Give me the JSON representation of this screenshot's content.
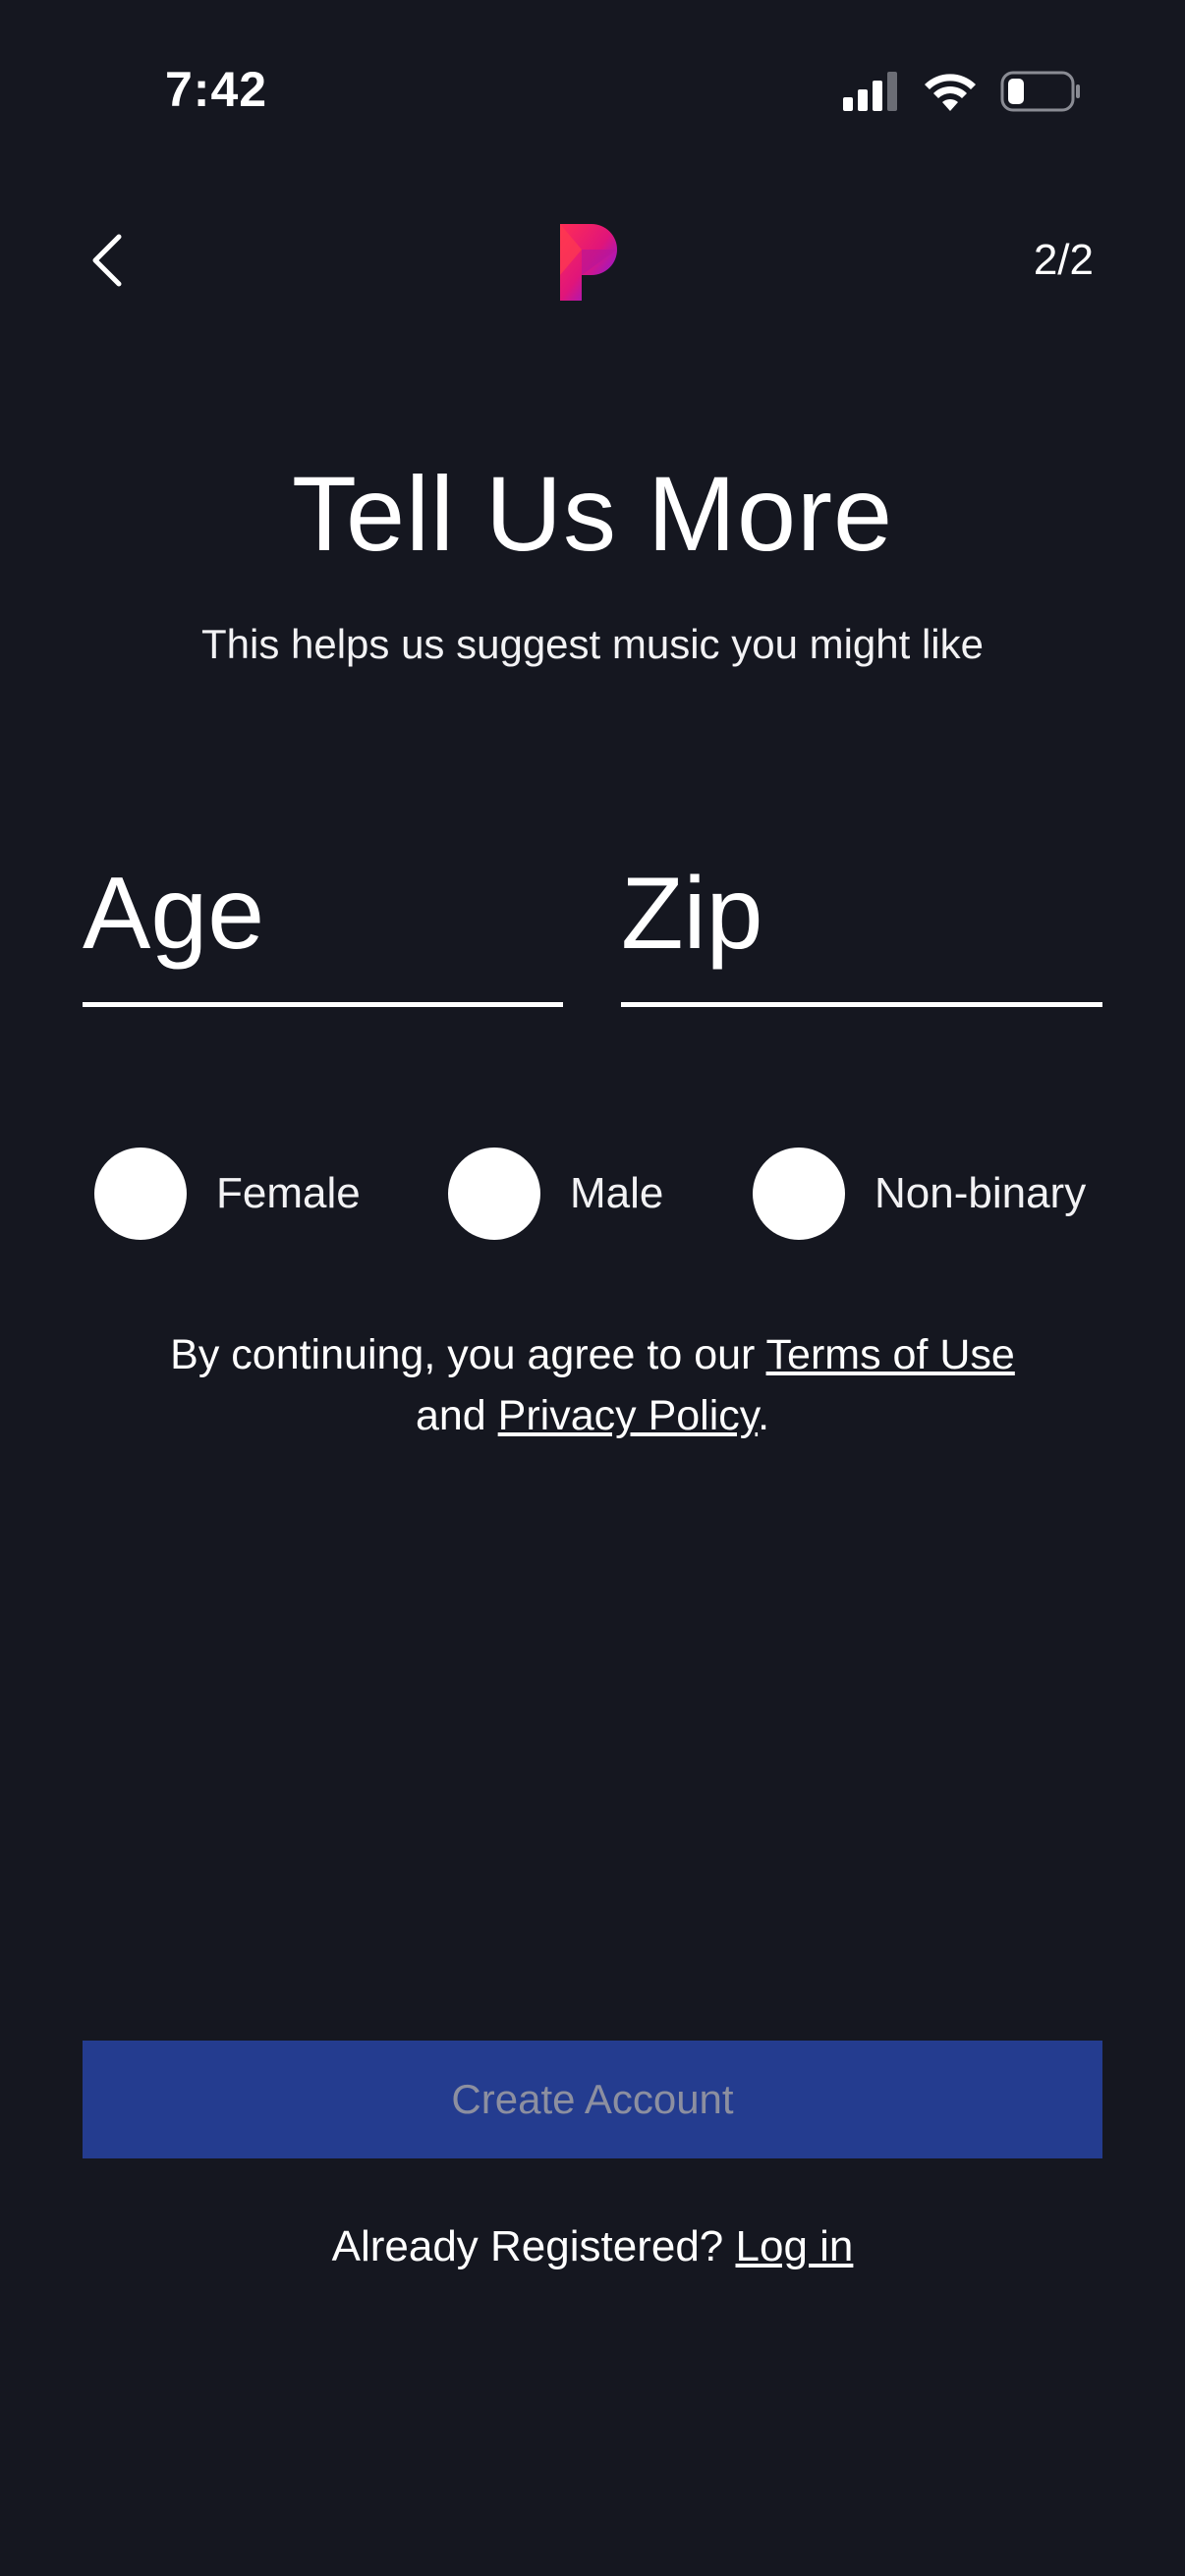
{
  "status_bar": {
    "time": "7:42",
    "icons": [
      "cellular-signal-icon",
      "wifi-icon",
      "battery-icon"
    ]
  },
  "header": {
    "back_icon": "chevron-left-icon",
    "logo": "pandora-logo",
    "step": "2/2"
  },
  "main": {
    "title": "Tell Us More",
    "subtitle": "This helps us suggest music you might like"
  },
  "form": {
    "age_placeholder": "Age",
    "zip_placeholder": "Zip",
    "gender_options": [
      {
        "label": "Female",
        "selected": false
      },
      {
        "label": "Male",
        "selected": false
      },
      {
        "label": "Non-binary",
        "selected": false
      }
    ]
  },
  "legal": {
    "prefix": "By continuing, you agree to our ",
    "terms_link": "Terms of Use",
    "middle": "and ",
    "privacy_link": "Privacy Policy",
    "suffix": "."
  },
  "actions": {
    "create_account": "Create Account",
    "login_prefix": "Already Registered? ",
    "login_link": "Log in"
  },
  "colors": {
    "background": "#151720",
    "button_bg": "#243c8f",
    "button_text": "#8c8fa0"
  }
}
